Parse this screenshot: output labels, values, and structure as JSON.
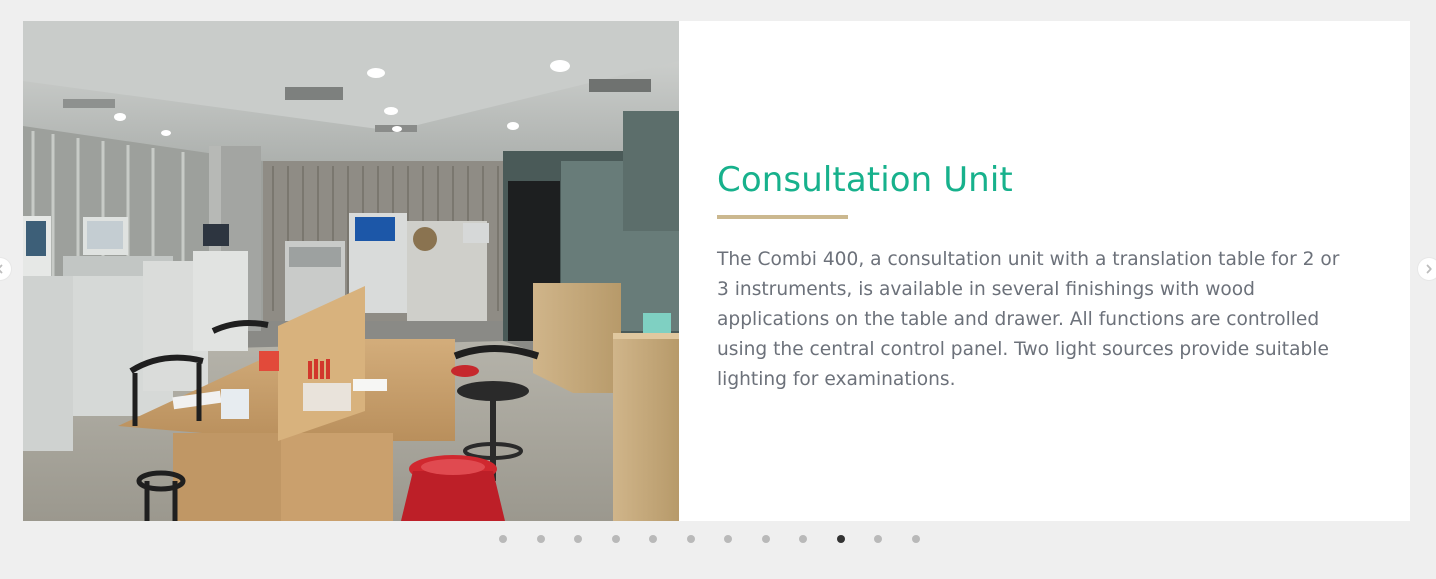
{
  "slide": {
    "title": "Consultation Unit",
    "description": "The Combi 400, a consultation unit with a translation table for 2 or 3 instruments, is available in several finishings with wood applications on the table and drawer. All functions are controlled using the central control panel. Two light sources provide suitable lighting for examinations."
  },
  "carousel": {
    "total_slides": 12,
    "active_slide": 10,
    "prev_icon": "chevron-left-icon",
    "next_icon": "chevron-right-icon"
  },
  "colors": {
    "title": "#17b18c",
    "divider": "#cbb88f",
    "text": "#6c717a",
    "page_background": "#efefef",
    "dot": "#b9b9b9",
    "dot_active": "#333333"
  }
}
